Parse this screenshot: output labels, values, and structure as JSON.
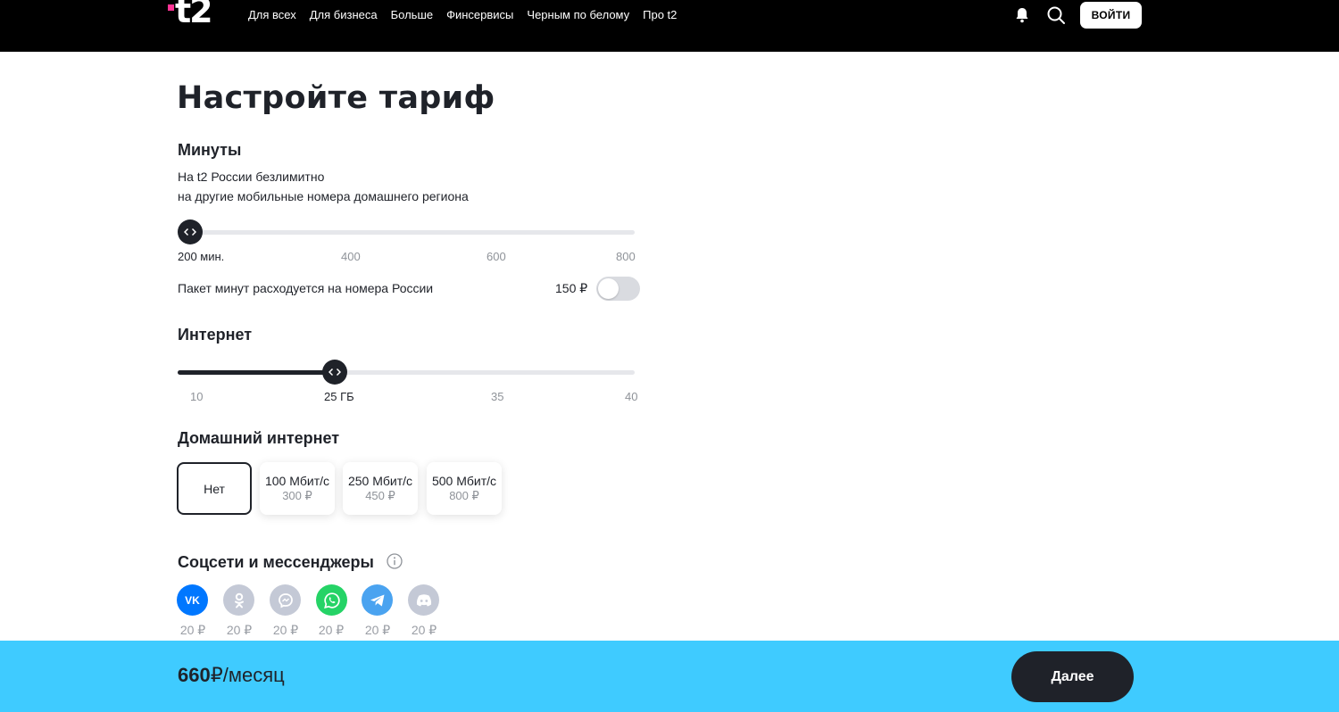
{
  "header": {
    "logo_text": "t2",
    "nav": [
      "Для всех",
      "Для бизнеса",
      "Больше",
      "Финсервисы",
      "Черным по белому",
      "Про t2"
    ],
    "login_label": "ВОЙТИ",
    "colors": {
      "bar": "#000000",
      "logo_accent": "#ff3495"
    }
  },
  "page_title": "Настройте тариф",
  "minutes": {
    "title": "Минуты",
    "desc_line1": "На t2 России безлимитно",
    "desc_line2": "на другие мобильные номера домашнего региона",
    "ticks": [
      "200 мин.",
      "400",
      "600",
      "800"
    ],
    "selected": "200 мин.",
    "value": 200,
    "range": [
      200,
      800
    ],
    "package_label": "Пакет минут расходуется на номера России",
    "package_price": "150 ₽",
    "package_enabled": false
  },
  "internet": {
    "title": "Интернет",
    "ticks": [
      "10",
      "25 ГБ",
      "35",
      "40"
    ],
    "selected": "25 ГБ",
    "value": 25,
    "range": [
      10,
      40
    ]
  },
  "home_internet": {
    "title": "Домашний интернет",
    "options": [
      {
        "name": "Нет",
        "price": ""
      },
      {
        "name": "100 Мбит/с",
        "price": "300 ₽"
      },
      {
        "name": "250 Мбит/с",
        "price": "450 ₽"
      },
      {
        "name": "500 Мбит/с",
        "price": "800 ₽"
      }
    ],
    "selected_index": 0
  },
  "social": {
    "title": "Соцсети и мессенджеры",
    "items": [
      {
        "icon": "vk-icon",
        "price": "20 ₽",
        "color": "#0077ff"
      },
      {
        "icon": "odnoklassniki-icon",
        "price": "20 ₽",
        "color": "#c4c9d6"
      },
      {
        "icon": "messenger-icon",
        "price": "20 ₽",
        "color": "#c4c9d6"
      },
      {
        "icon": "whatsapp-icon",
        "price": "20 ₽",
        "color": "#25d366"
      },
      {
        "icon": "telegram-icon",
        "price": "20 ₽",
        "color": "#4aa3f0"
      },
      {
        "icon": "discord-icon",
        "price": "20 ₽",
        "color": "#c4c9d6"
      }
    ]
  },
  "footer": {
    "price_value": "660",
    "price_unit": "₽/месяц",
    "next_label": "Далее",
    "bar_color": "#3fcbff"
  }
}
